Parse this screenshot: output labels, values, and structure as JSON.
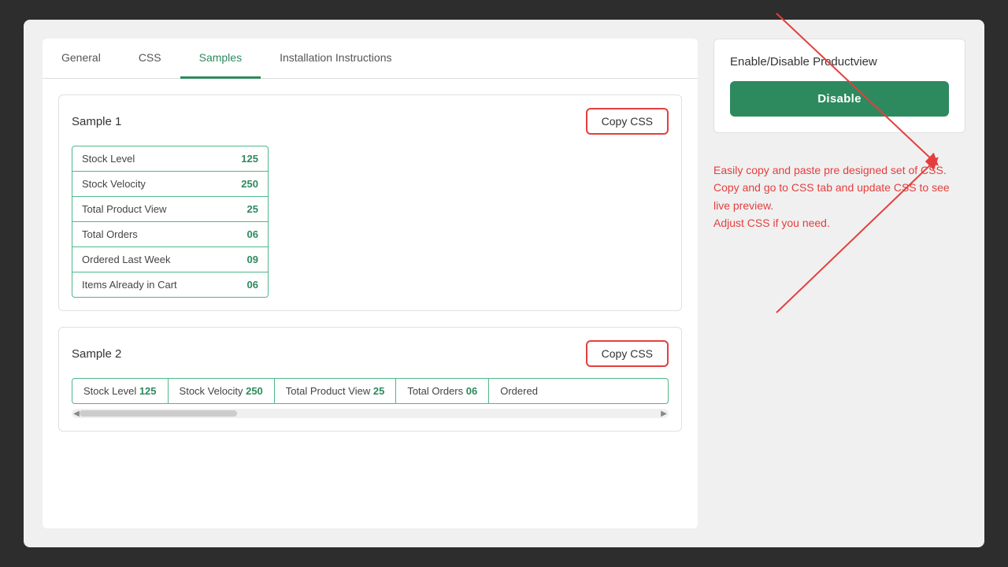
{
  "tabs": [
    {
      "label": "General",
      "active": false
    },
    {
      "label": "CSS",
      "active": false
    },
    {
      "label": "Samples",
      "active": true
    },
    {
      "label": "Installation Instructions",
      "active": false
    }
  ],
  "sample1": {
    "title": "Sample 1",
    "copy_btn": "Copy CSS",
    "rows": [
      {
        "label": "Stock Level",
        "value": "125"
      },
      {
        "label": "Stock Velocity",
        "value": "250"
      },
      {
        "label": "Total Product View",
        "value": "25"
      },
      {
        "label": "Total Orders",
        "value": "06"
      },
      {
        "label": "Ordered Last Week",
        "value": "09"
      },
      {
        "label": "Items Already in Cart",
        "value": "06"
      }
    ]
  },
  "sample2": {
    "title": "Sample 2",
    "copy_btn": "Copy CSS",
    "cells": [
      {
        "label": "Stock Level",
        "value": "125"
      },
      {
        "label": "Stock Velocity",
        "value": "250"
      },
      {
        "label": "Total Product View",
        "value": "25"
      },
      {
        "label": "Total Orders",
        "value": "06"
      },
      {
        "label": "Ordered",
        "value": ""
      }
    ]
  },
  "right_panel": {
    "enable_disable_title": "Enable/Disable Productview",
    "disable_btn": "Disable",
    "annotation": "Easily copy and paste pre designed set of CSS.\nCopy and go to CSS tab and update CSS to see live preview.\nAdjust CSS if you need."
  }
}
